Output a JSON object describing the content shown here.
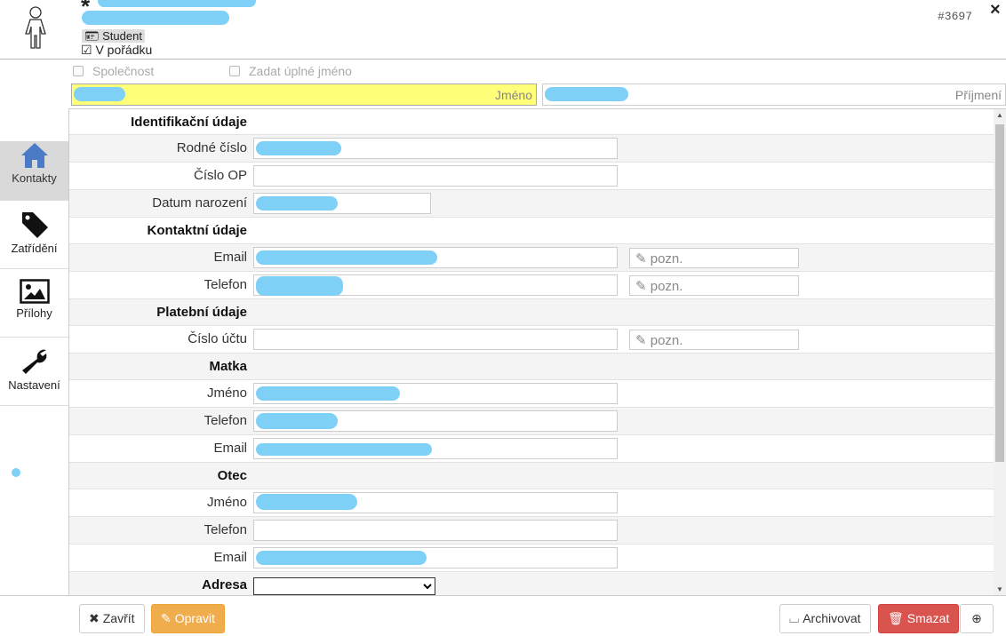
{
  "header": {
    "badge": "Student",
    "status": "V pořádku",
    "record_id": "#3697",
    "close": "×",
    "star": "*"
  },
  "options": {
    "company": "Společnost",
    "full_name": "Zadat úplné jméno"
  },
  "name": {
    "first_label": "Jméno",
    "last_label": "Příjmení"
  },
  "sidebar": {
    "items": [
      {
        "label": "Kontakty",
        "icon": "home-icon",
        "active": true
      },
      {
        "label": "Zatřídění",
        "icon": "tag-icon"
      },
      {
        "label": "Přílohy",
        "icon": "image-icon"
      },
      {
        "label": "Nastavení",
        "icon": "wrench-icon"
      }
    ]
  },
  "form": {
    "sec_ident": "Identifikační údaje",
    "birth_number": "Rodné číslo",
    "id_card": "Číslo OP",
    "birth_date": "Datum narození",
    "sec_contact": "Kontaktní údaje",
    "email": "Email",
    "phone": "Telefon",
    "note_placeholder": "pozn.",
    "sec_payment": "Platební údaje",
    "account": "Číslo účtu",
    "sec_mother": "Matka",
    "sec_father": "Otec",
    "first_name": "Jméno",
    "address": "Adresa"
  },
  "footer": {
    "close": "Zavřít",
    "edit": "Opravit",
    "archive": "Archivovat",
    "delete": "Smazat"
  },
  "colors": {
    "highlight": "#ffff7a",
    "edit": "#f0ad4e",
    "delete": "#d9534f",
    "redaction": "#7fd0f7"
  }
}
